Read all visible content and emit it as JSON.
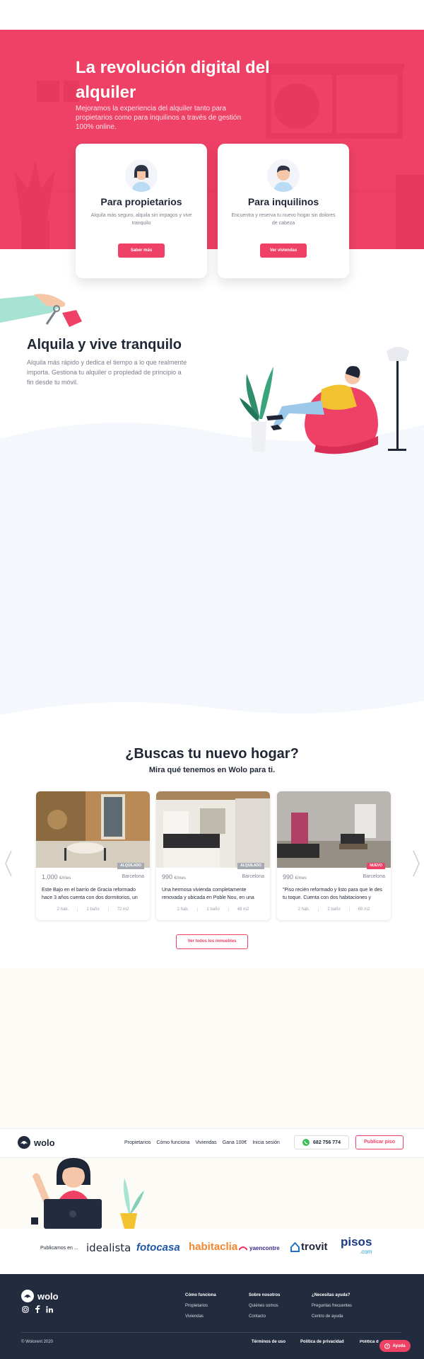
{
  "colors": {
    "primary": "#ef4166",
    "dark": "#232b3e",
    "muted": "#7a7f8c"
  },
  "hero": {
    "title": "La revolución digital del alquiler",
    "subtitle": "Mejoramos la experiencia del alquiler tanto para propietarios como para inquilinos a través de gestión 100% online."
  },
  "cards": [
    {
      "title": "Para propietarios",
      "text": "Alquila más seguro, alquila sin impagos y vive tranquilo",
      "button": "Saber más",
      "avatar_icon": "woman-avatar-icon"
    },
    {
      "title": "Para inquilinos",
      "text": "Encuentra y reserva tu nuevo hogar sin dolores de cabeza",
      "button": "Ver viviendas",
      "avatar_icon": "man-avatar-icon"
    }
  ],
  "section2": {
    "title": "Alquila y vive tranquilo",
    "text": "Alquila más rápido y dedica el tiempo a lo que realmente importa. Gestiona tu alquiler o propiedad de principio a fin desde tu móvil."
  },
  "listings": {
    "title": "¿Buscas tu nuevo hogar?",
    "subtitle": "Mira qué tenemos en Wolo para ti.",
    "unit": "€/mes",
    "items": [
      {
        "badge": "ALQUILADO",
        "badge_color": "#a5a9b2",
        "price": "1.000",
        "city": "Barcelona",
        "desc": "Este Bajo en el barrio de Gracia reformado hace 3 años cuenta con dos dormitorios, un",
        "rooms": "2 hab.",
        "baths": "1 baño",
        "size": "72 m2"
      },
      {
        "badge": "ALQUILADO",
        "badge_color": "#a5a9b2",
        "price": "990",
        "city": "Barcelona",
        "desc": "Una hermosa vivienda completamente renovada y ubicada en Poble Nou, en una",
        "rooms": "2 hab.",
        "baths": "1 baño",
        "size": "48 m2"
      },
      {
        "badge": "NUEVO",
        "badge_color": "#ef4166",
        "price": "990",
        "city": "Barcelona",
        "desc": "\"Piso recién reformado y listo para que le des tu toque. Cuenta con dos habitaciones y",
        "rooms": "2 hab.",
        "baths": "2 baño",
        "size": "69 m2"
      }
    ],
    "all_button": "Ver todos los inmuebles"
  },
  "nav": {
    "logo": "wolo",
    "links": [
      "Propietarios",
      "Cómo funciona",
      "Viviendas",
      "Gana 100€",
      "Inicia sesión"
    ],
    "phone": "682 756 774",
    "publish": "Publicar piso"
  },
  "portals": {
    "label": "Publicamos en ...",
    "brands": [
      "idealista",
      "fotocasa",
      "habitaclia",
      "yaencontre",
      "trovit",
      "pisos"
    ],
    "brand_suffix": ".com"
  },
  "footer": {
    "logo": "wolo",
    "social": [
      "instagram-icon",
      "facebook-icon",
      "linkedin-icon"
    ],
    "cols": [
      {
        "title": "Cómo funciona",
        "links": [
          "Propietarios",
          "Viviendas"
        ]
      },
      {
        "title": "Sobre nosotros",
        "links": [
          "Quiénes somos",
          "Contacto"
        ]
      },
      {
        "title": "¿Necesitas ayuda?",
        "links": [
          "Preguntas frecuentes",
          "Centro de ayuda"
        ]
      }
    ],
    "copyright": "© Wolorent 2020",
    "legal": [
      "Términos de uso",
      "Política de privacidad",
      "Política d"
    ],
    "help": "Ayuda"
  }
}
